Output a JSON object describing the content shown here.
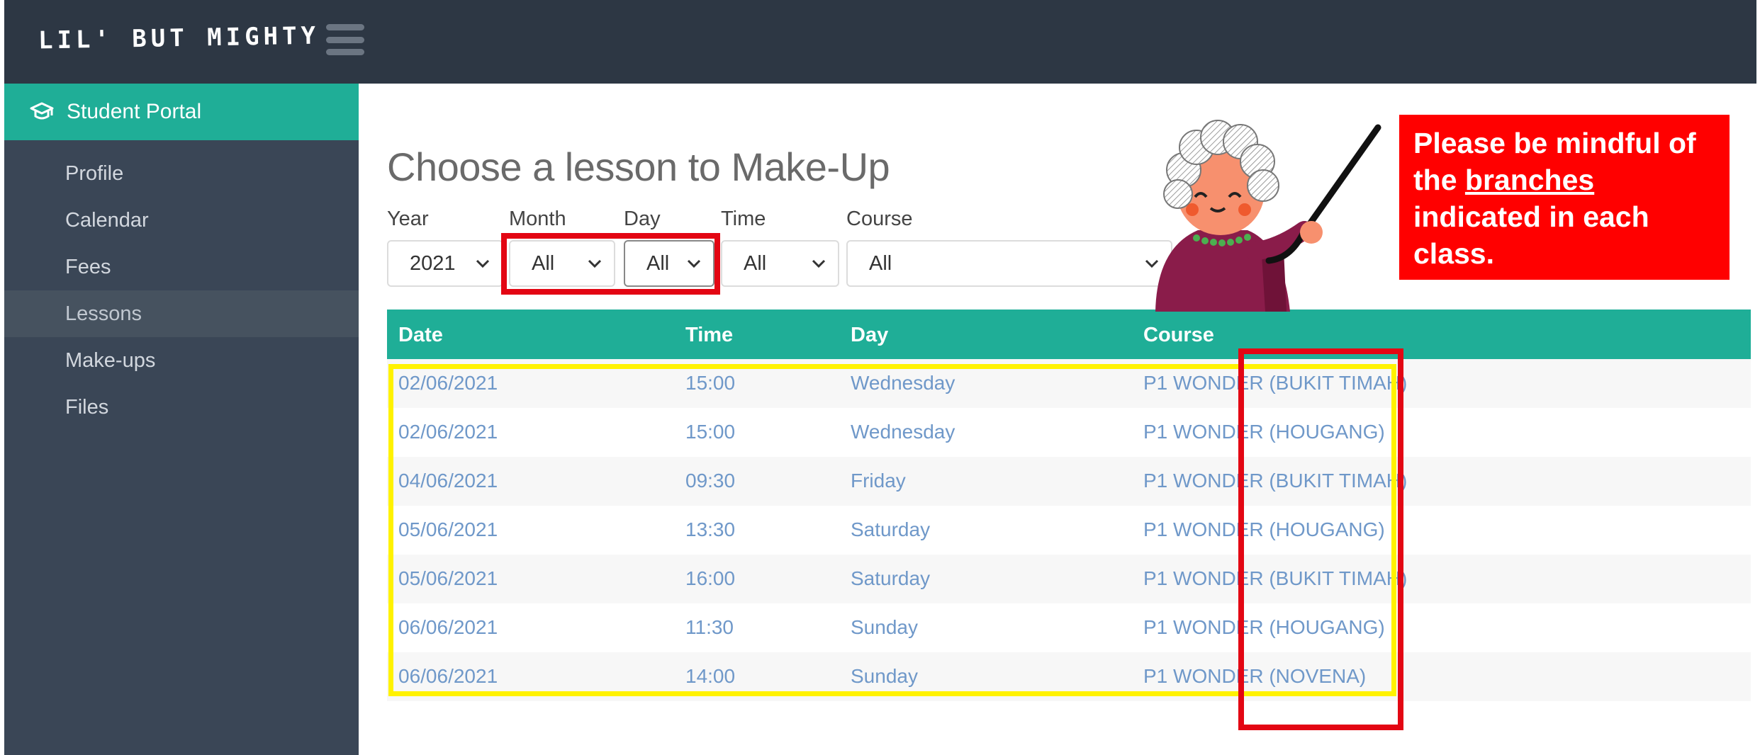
{
  "brand": {
    "name": "LIL' BUT MIGHTY"
  },
  "sidebar": {
    "portal_label": "Student Portal",
    "items": [
      {
        "label": "Profile"
      },
      {
        "label": "Calendar"
      },
      {
        "label": "Fees"
      },
      {
        "label": "Lessons",
        "active": true
      },
      {
        "label": "Make-ups"
      },
      {
        "label": "Files"
      }
    ]
  },
  "main": {
    "title": "Choose a lesson to Make-Up",
    "filters": {
      "year": {
        "label": "Year",
        "value": "2021"
      },
      "month": {
        "label": "Month",
        "value": "All"
      },
      "day": {
        "label": "Day",
        "value": "All"
      },
      "time": {
        "label": "Time",
        "value": "All"
      },
      "course": {
        "label": "Course",
        "value": "All"
      }
    },
    "table": {
      "headers": [
        "Date",
        "Time",
        "Day",
        "Course"
      ],
      "rows": [
        {
          "date": "02/06/2021",
          "time": "15:00",
          "day": "Wednesday",
          "course": "P1 WONDER (BUKIT TIMAH)"
        },
        {
          "date": "02/06/2021",
          "time": "15:00",
          "day": "Wednesday",
          "course": "P1 WONDER (HOUGANG)"
        },
        {
          "date": "04/06/2021",
          "time": "09:30",
          "day": "Friday",
          "course": "P1 WONDER (BUKIT TIMAH)"
        },
        {
          "date": "05/06/2021",
          "time": "13:30",
          "day": "Saturday",
          "course": "P1 WONDER (HOUGANG)"
        },
        {
          "date": "05/06/2021",
          "time": "16:00",
          "day": "Saturday",
          "course": "P1 WONDER (BUKIT TIMAH)"
        },
        {
          "date": "06/06/2021",
          "time": "11:30",
          "day": "Sunday",
          "course": "P1 WONDER (HOUGANG)"
        },
        {
          "date": "06/06/2021",
          "time": "14:00",
          "day": "Sunday",
          "course": "P1 WONDER (NOVENA)"
        }
      ]
    }
  },
  "notice": {
    "line1": "Please be mindful of",
    "the": "the",
    "branches": "branches",
    "line3": "indicated in each",
    "line4": "class."
  },
  "colors": {
    "topbar": "#2d3744",
    "sidebar": "#3a4656",
    "accent": "#1fae97",
    "link": "#6f98c9",
    "annotation_red": "#e30613",
    "annotation_yellow": "#fff200"
  }
}
